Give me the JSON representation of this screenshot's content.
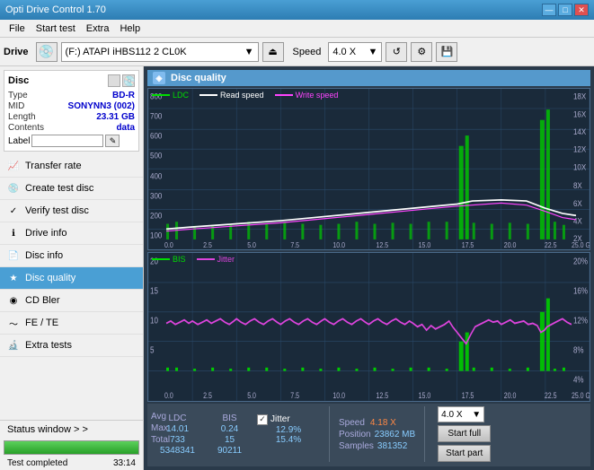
{
  "titlebar": {
    "title": "Opti Drive Control 1.70",
    "controls": [
      "—",
      "□",
      "✕"
    ]
  },
  "menubar": {
    "items": [
      "File",
      "Start test",
      "Extra",
      "Help"
    ]
  },
  "toolbar": {
    "drive_label": "Drive",
    "drive_value": "(F:)  ATAPI iHBS112  2 CL0K",
    "speed_label": "Speed",
    "speed_value": "4.0 X"
  },
  "disc_panel": {
    "title": "Disc",
    "type_label": "Type",
    "type_val": "BD-R",
    "mid_label": "MID",
    "mid_val": "SONYNN3 (002)",
    "length_label": "Length",
    "length_val": "23.31 GB",
    "contents_label": "Contents",
    "contents_val": "data",
    "label_label": "Label"
  },
  "sidebar_nav": {
    "items": [
      {
        "id": "transfer-rate",
        "label": "Transfer rate",
        "icon": "📈"
      },
      {
        "id": "create-test-disc",
        "label": "Create test disc",
        "icon": "💿"
      },
      {
        "id": "verify-test-disc",
        "label": "Verify test disc",
        "icon": "✓"
      },
      {
        "id": "drive-info",
        "label": "Drive info",
        "icon": "ℹ"
      },
      {
        "id": "disc-info",
        "label": "Disc info",
        "icon": "📄"
      },
      {
        "id": "disc-quality",
        "label": "Disc quality",
        "icon": "★",
        "active": true
      },
      {
        "id": "cd-bler",
        "label": "CD Bler",
        "icon": "◉"
      },
      {
        "id": "fe-te",
        "label": "FE / TE",
        "icon": "~"
      },
      {
        "id": "extra-tests",
        "label": "Extra tests",
        "icon": "🔬"
      }
    ]
  },
  "status_window": {
    "label": "Status window > >",
    "progress_pct": 100,
    "status_text": "Test completed",
    "time": "33:14"
  },
  "disc_quality": {
    "title": "Disc quality",
    "legend": {
      "ldc": "LDC",
      "read_speed": "Read speed",
      "write_speed": "Write speed",
      "bis": "BIS",
      "jitter": "Jitter"
    },
    "chart1_ymax": 800,
    "chart1_y2max": 18,
    "chart2_ymax": 20,
    "chart2_y2max": 20,
    "x_max": "25.0 GB",
    "stats": {
      "avg_label": "Avg",
      "max_label": "Max",
      "total_label": "Total",
      "ldc_header": "LDC",
      "bis_header": "BIS",
      "jitter_header": "Jitter",
      "speed_header": "Speed",
      "ldc_avg": "14.01",
      "ldc_max": "733",
      "ldc_total": "5348341",
      "bis_avg": "0.24",
      "bis_max": "15",
      "bis_total": "90211",
      "jitter_avg": "12.9%",
      "jitter_max": "15.4%",
      "jitter_total": "",
      "speed_val": "4.18 X",
      "speed_label_static": "4.0 X",
      "position_label": "Position",
      "position_val": "23862 MB",
      "samples_label": "Samples",
      "samples_val": "381352",
      "start_full": "Start full",
      "start_part": "Start part",
      "jitter_check": "Jitter"
    }
  },
  "colors": {
    "ldc_color": "#00dd00",
    "read_speed_color": "#ffffff",
    "write_speed_color": "#ff44ff",
    "bis_color": "#00dd00",
    "jitter_color": "#dd44dd",
    "chart_bg": "#1a2a3a",
    "grid_color": "#2a4a6a",
    "accent_blue": "#4a9fd4",
    "text_blue": "#88ccff",
    "text_orange": "#ff8844"
  }
}
